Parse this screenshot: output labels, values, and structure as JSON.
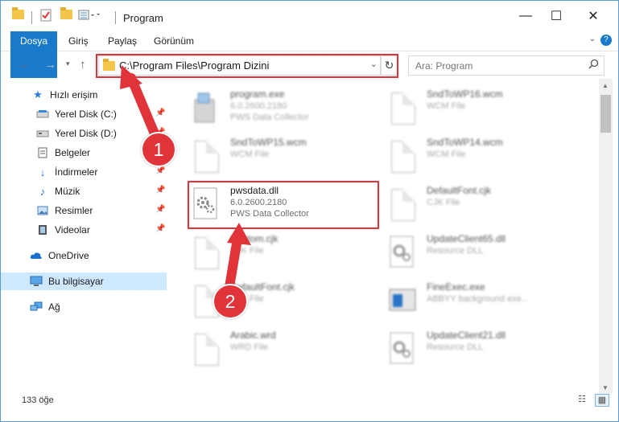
{
  "window": {
    "title": "Program",
    "controls": {
      "minimize": "—",
      "maximize": "☐",
      "close": "✕"
    }
  },
  "ribbon": {
    "tabs": [
      "Dosya",
      "Giriş",
      "Paylaş",
      "Görünüm"
    ],
    "help": "?"
  },
  "address_bar": {
    "path": "C:\\Program Files\\Program Dizini",
    "search_placeholder": "Ara: Program"
  },
  "sidebar": {
    "items": [
      {
        "label": "Hızlı erişim",
        "icon": "star-icon",
        "pinned": false
      },
      {
        "label": "Yerel Disk (C:)",
        "icon": "drive-icon",
        "pinned": true
      },
      {
        "label": "Yerel Disk (D:)",
        "icon": "drive-icon",
        "pinned": true
      },
      {
        "label": "Belgeler",
        "icon": "documents-icon",
        "pinned": true
      },
      {
        "label": "İndirmeler",
        "icon": "download-icon",
        "pinned": true
      },
      {
        "label": "Müzik",
        "icon": "music-icon",
        "pinned": true
      },
      {
        "label": "Resimler",
        "icon": "pictures-icon",
        "pinned": true
      },
      {
        "label": "Videolar",
        "icon": "videos-icon",
        "pinned": true
      },
      {
        "label": "OneDrive",
        "icon": "cloud-icon",
        "pinned": false
      },
      {
        "label": "Bu bilgisayar",
        "icon": "computer-icon",
        "pinned": false,
        "selected": true
      },
      {
        "label": "Ağ",
        "icon": "network-icon",
        "pinned": false
      }
    ]
  },
  "files": [
    {
      "name": "program.exe",
      "line2": "6.0.2600.2180",
      "line3": "PWS Data Collector",
      "icon": "installer-icon",
      "emphasized": false
    },
    {
      "name": "SndToWP16.wcm",
      "line2": "WCM File",
      "line3": "",
      "icon": "blank-file-icon",
      "emphasized": false
    },
    {
      "name": "SndToWP15.wcm",
      "line2": "WCM File",
      "line3": "",
      "icon": "blank-file-icon",
      "emphasized": false
    },
    {
      "name": "SndToWP14.wcm",
      "line2": "WCM File",
      "line3": "",
      "icon": "blank-file-icon",
      "emphasized": false
    },
    {
      "name": "pwsdata.dll",
      "line2": "6.0.2600.2180",
      "line3": "PWS Data Collector",
      "icon": "dll-gear-icon",
      "emphasized": true
    },
    {
      "name": "DefaultFont.cjk",
      "line2": "CJK File",
      "line3": "",
      "icon": "blank-file-icon",
      "emphasized": false
    },
    {
      "name": "Custom.cjk",
      "line2": "CJK File",
      "line3": "",
      "icon": "blank-file-icon",
      "emphasized": false
    },
    {
      "name": "UpdateClient65.dll",
      "line2": "Resource DLL",
      "line3": "",
      "icon": "dll-gear-icon",
      "emphasized": false
    },
    {
      "name": "DefaultFont.cjk",
      "line2": "CJK File",
      "line3": "",
      "icon": "blank-file-icon",
      "emphasized": false
    },
    {
      "name": "FineExec.exe",
      "line2": "ABBYY background exe...",
      "line3": "",
      "icon": "app-icon",
      "emphasized": false
    },
    {
      "name": "Arabic.wrd",
      "line2": "WRD File",
      "line3": "",
      "icon": "blank-file-icon",
      "emphasized": false
    },
    {
      "name": "UpdateClient21.dll",
      "line2": "Resource DLL",
      "line3": "",
      "icon": "dll-gear-icon",
      "emphasized": false
    }
  ],
  "status": {
    "count": "133 öğe"
  },
  "annotations": {
    "step1": "1",
    "step2": "2"
  },
  "colors": {
    "accent": "#1979ca",
    "annotation": "#e1343a",
    "selection": "#cde8ff"
  }
}
